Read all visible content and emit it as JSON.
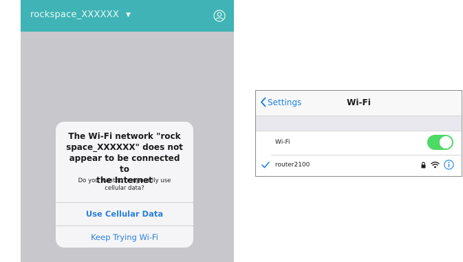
{
  "app": {
    "network_selector": "rockspace_XXXXXX",
    "dialog": {
      "title": "The Wi-Fi network \"rock\nspace_XXXXXX\" does not\nappear to be connected to\nthe Internet",
      "message": "Do you want to temporarily use\ncellular data?",
      "primary_button": "Use Cellular Data",
      "secondary_button": "Keep Trying Wi-Fi"
    },
    "colors": {
      "header": "#3fb3b5",
      "overlay": "#c7c7cc",
      "button_text": "#2a7fd9"
    }
  },
  "settings": {
    "back_label": "Settings",
    "title": "Wi-Fi",
    "wifi_label": "Wi-Fi",
    "wifi_enabled": true,
    "connected_network": "router2100",
    "icons": [
      "chevron-left-icon",
      "checkmark-icon",
      "lock-icon",
      "wifi-signal-icon",
      "info-icon"
    ],
    "colors": {
      "accent": "#1e82e6",
      "toggle_on": "#4cd964"
    }
  }
}
